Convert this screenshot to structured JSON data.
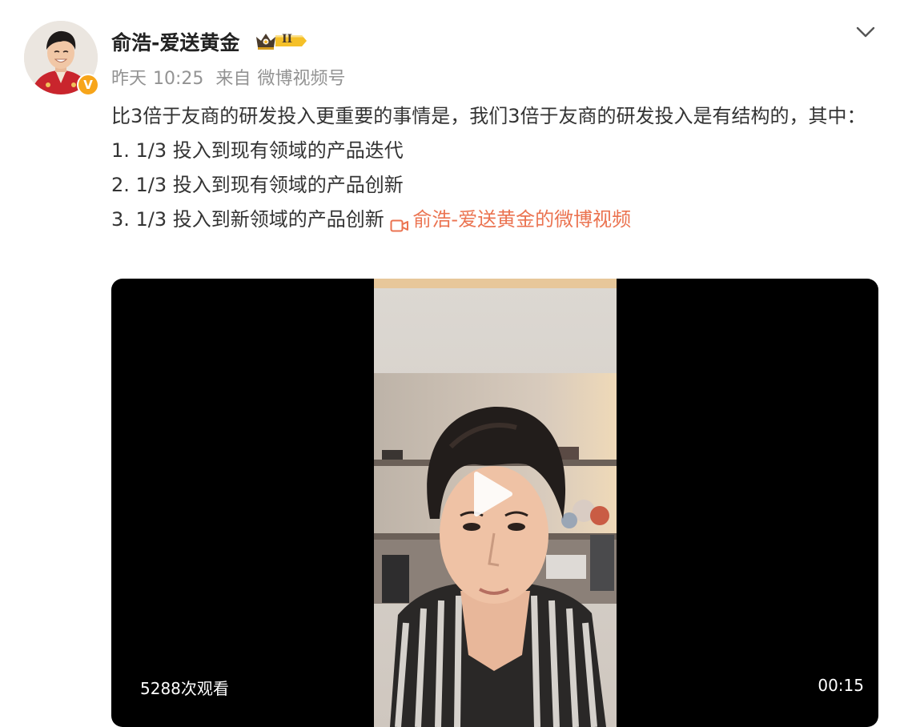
{
  "post": {
    "author": {
      "name": "俞浩-爱送黄金",
      "avatar_icon": "user-avatar",
      "verified_mark": "V",
      "badge_level": "II",
      "badge_icon": "crown-badge-icon"
    },
    "meta": {
      "date": "昨天",
      "time": "10:25",
      "source_prefix": "来自",
      "source": "微博视频号"
    },
    "text": {
      "line1": "比3倍于友商的研发投入更重要的事情是，我们3倍于友商的研发投入是有结构的，其中：",
      "line2": "1. 1/3 投入到现有领域的产品迭代",
      "line3": "2. 1/3 投入到现有领域的产品创新",
      "line4": "3. 1/3 投入到新领域的产品创新",
      "video_link": "俞浩-爱送黄金的微博视频"
    },
    "video": {
      "views": "5288次观看",
      "duration": "00:15",
      "play_icon": "play-icon"
    }
  },
  "colors": {
    "link": "#eb7350",
    "meta_text": "#939393",
    "verified": "#f7a51a",
    "badge": "#f5c028"
  }
}
